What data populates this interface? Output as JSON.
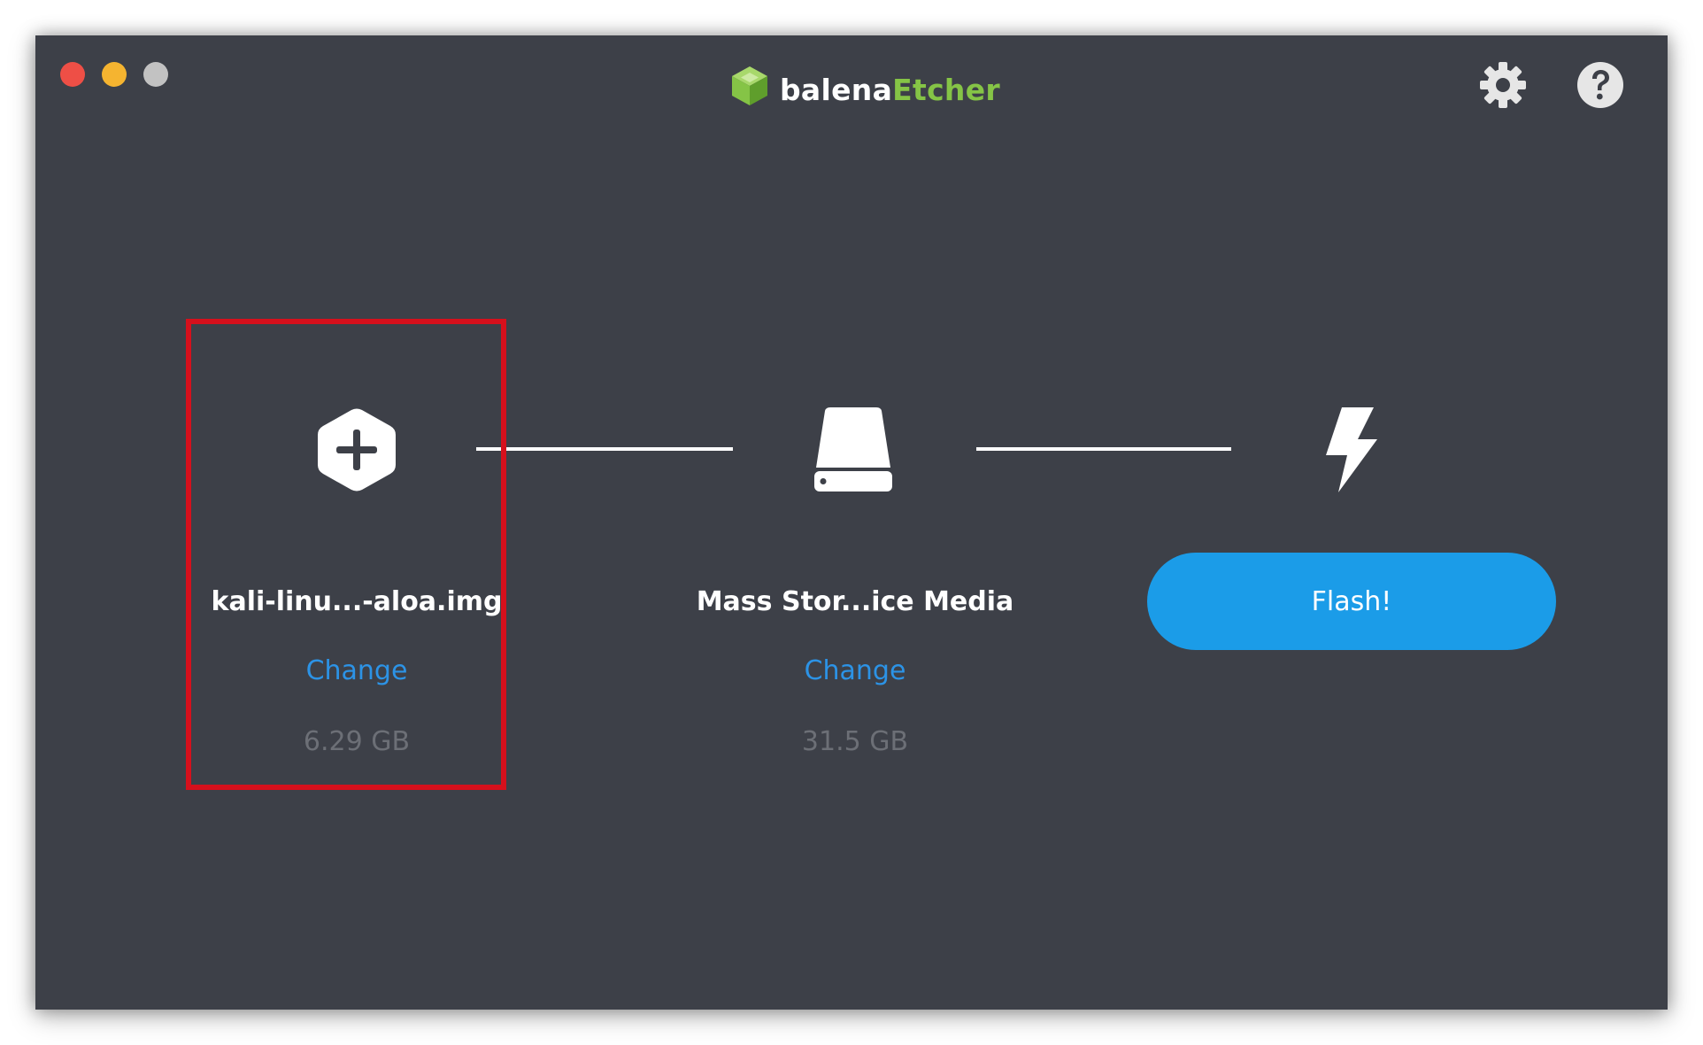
{
  "window": {
    "controls": [
      "close",
      "minimize",
      "maximize"
    ]
  },
  "header": {
    "brand_part1": "balena",
    "brand_part2": "Etcher",
    "brand_icon": "cube-logo-icon",
    "settings_icon": "gear-icon",
    "help_icon": "help-icon"
  },
  "steps": {
    "image": {
      "icon": "hexagon-plus-icon",
      "title": "kali-linu...-aloa.img",
      "change_label": "Change",
      "size": "6.29 GB"
    },
    "drive": {
      "icon": "drive-icon",
      "title": "Mass Stor...ice Media",
      "change_label": "Change",
      "size": "31.5 GB"
    },
    "flash": {
      "icon": "lightning-icon",
      "button_label": "Flash!"
    }
  },
  "colors": {
    "background": "#3d4048",
    "accent": "#1b9ce8",
    "link": "#2c93e6",
    "brand_green": "#85c446",
    "highlight_red": "#d6101c"
  }
}
